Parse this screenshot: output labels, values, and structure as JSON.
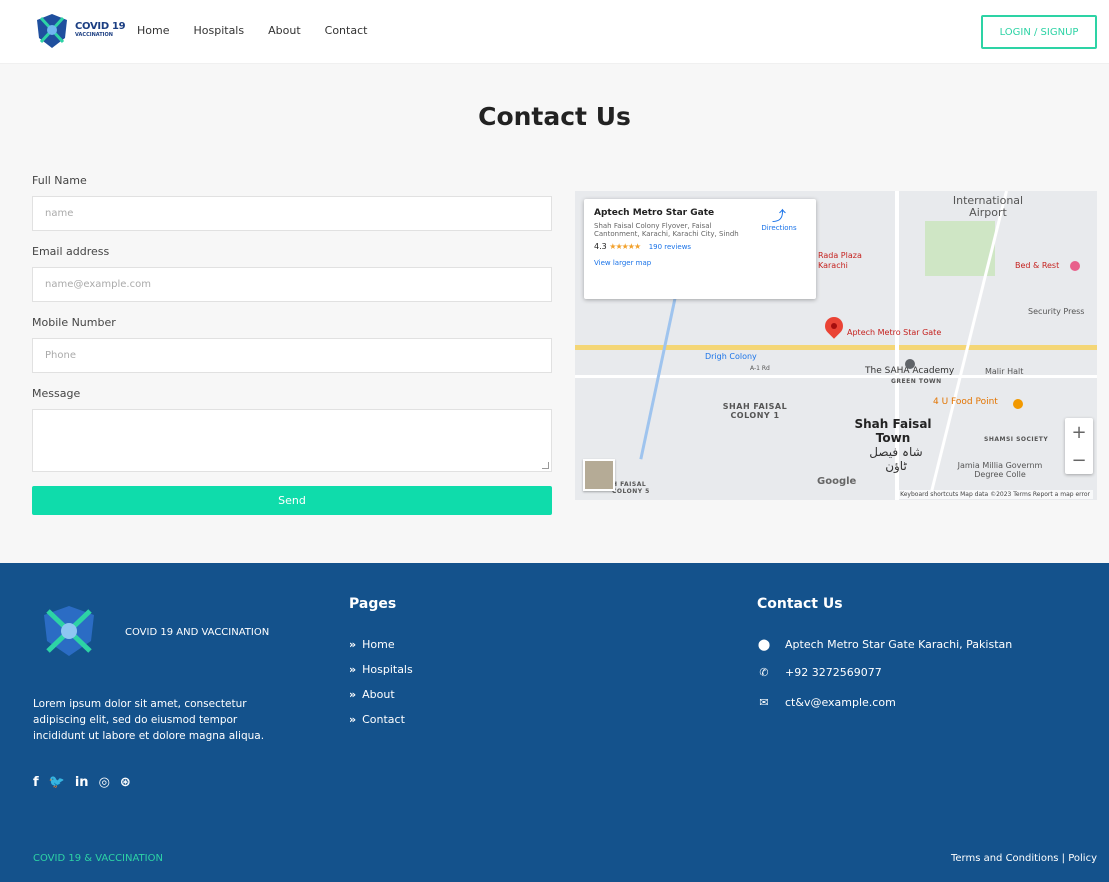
{
  "header": {
    "logo_text": "COVID 19",
    "logo_subtext": "VACCINATION",
    "nav": [
      "Home",
      "Hospitals",
      "About",
      "Contact"
    ],
    "login_label": "LOGIN / SIGNUP"
  },
  "contact": {
    "title": "Contact Us",
    "fields": {
      "full_name": {
        "label": "Full Name",
        "placeholder": "name"
      },
      "email": {
        "label": "Email address",
        "placeholder": "name@example.com"
      },
      "mobile": {
        "label": "Mobile Number",
        "placeholder": "Phone"
      },
      "message": {
        "label": "Message",
        "placeholder": ""
      }
    },
    "send_label": "Send"
  },
  "map": {
    "place_title": "Aptech Metro Star Gate",
    "place_address": "Shah Faisal Colony Flyover, Faisal Cantonment, Karachi, Karachi City, Sindh",
    "rating": "4.3",
    "stars": "★★★★★",
    "reviews": "190 reviews",
    "view_larger": "View larger map",
    "directions": "Directions",
    "labels": {
      "airport": "International Airport",
      "plaza": "Rada Plaza Karachi",
      "bed_rest": "Bed & Rest",
      "security": "Security Press",
      "pin": "Aptech Metro Star Gate",
      "drigh": "Drigh Colony",
      "saha": "The SAHA Academy",
      "green_town": "GREEN TOWN",
      "shah_colony": "SHAH FAISAL COLONY 1",
      "food": "4 U Food Point",
      "shah_town": "Shah Faisal Town",
      "shah_urdu": "شاہ فیصل ٹاؤن",
      "shamsi": "SHAMSI SOCIETY",
      "jamia": "Jamia Millia Governm Degree Colle",
      "colony5": "H FAISAL COLONY 5",
      "malir": "Malir Halt",
      "a1": "A-1 Rd"
    },
    "google": "Google",
    "footer_text": "Keyboard shortcuts   Map data ©2023   Terms   Report a map error",
    "zoom_in": "+",
    "zoom_out": "−"
  },
  "footer": {
    "brand": "COVID 19 AND VACCINATION",
    "description": "Lorem ipsum dolor sit amet, consectetur adipiscing elit, sed do eiusmod tempor incididunt ut labore et dolore magna aliqua.",
    "social": [
      "f",
      "twitter",
      "in",
      "instagram",
      "dribbble"
    ],
    "pages_heading": "Pages",
    "pages": [
      "Home",
      "Hospitals",
      "About",
      "Contact"
    ],
    "contact_heading": "Contact Us",
    "address": "Aptech Metro Star Gate Karachi, Pakistan",
    "phone": "+92 3272569077",
    "email": "ct&v@example.com",
    "bottom_left": "COVID 19 & VACCINATION",
    "bottom_right": "Terms and Conditions  |  Policy"
  },
  "colors": {
    "accent": "#0fdcab",
    "footer_bg": "#14528c",
    "brand_blue": "#1b3e82"
  }
}
